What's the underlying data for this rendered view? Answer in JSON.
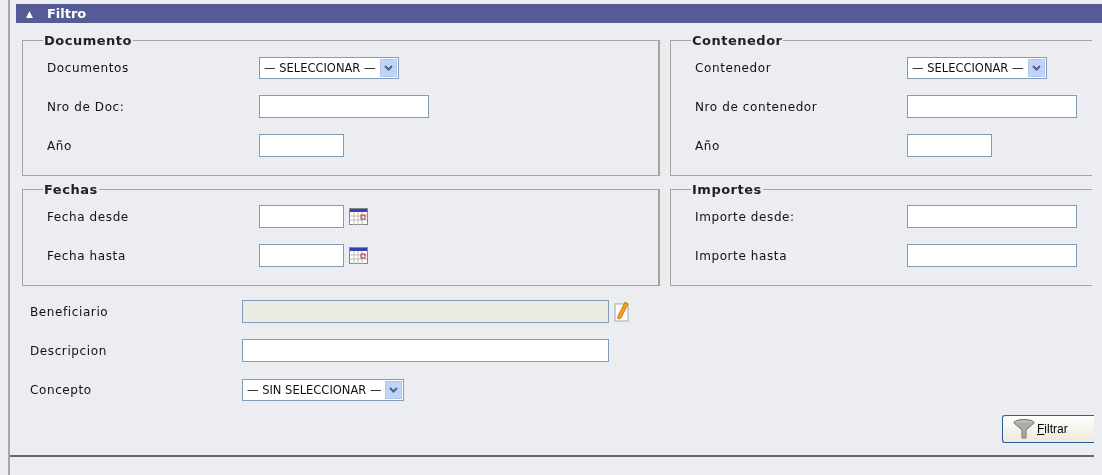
{
  "panel": {
    "arrow": "▲",
    "title": "Filtro"
  },
  "groups": [
    {
      "legend": "Documento",
      "fields": [
        {
          "kind": "select",
          "label": "Documentos",
          "value": "— SELECCIONAR —"
        },
        {
          "kind": "text",
          "label": "Nro de Doc:"
        },
        {
          "kind": "short",
          "label": "Año"
        }
      ]
    },
    {
      "legend": "Contenedor",
      "fields": [
        {
          "kind": "select",
          "label": "Contenedor",
          "value": "— SELECCIONAR —"
        },
        {
          "kind": "text",
          "label": "Nro de contenedor"
        },
        {
          "kind": "short",
          "label": "Año"
        }
      ]
    },
    {
      "legend": "Fechas",
      "fields": [
        {
          "kind": "date",
          "label": "Fecha desde"
        },
        {
          "kind": "date",
          "label": "Fecha hasta"
        }
      ]
    },
    {
      "legend": "Importes",
      "fields": [
        {
          "kind": "text",
          "label": "Importe desde:"
        },
        {
          "kind": "text",
          "label": "Importe hasta"
        }
      ]
    }
  ],
  "fields": [
    {
      "kind": "lookup",
      "label": "Beneficiario",
      "disabled": true
    },
    {
      "kind": "wide",
      "label": "Descripcion",
      "disabled": false
    },
    {
      "kind": "select",
      "label": "Concepto",
      "value": "— SIN SELECCIONAR —"
    }
  ],
  "button": "Filtrar"
}
